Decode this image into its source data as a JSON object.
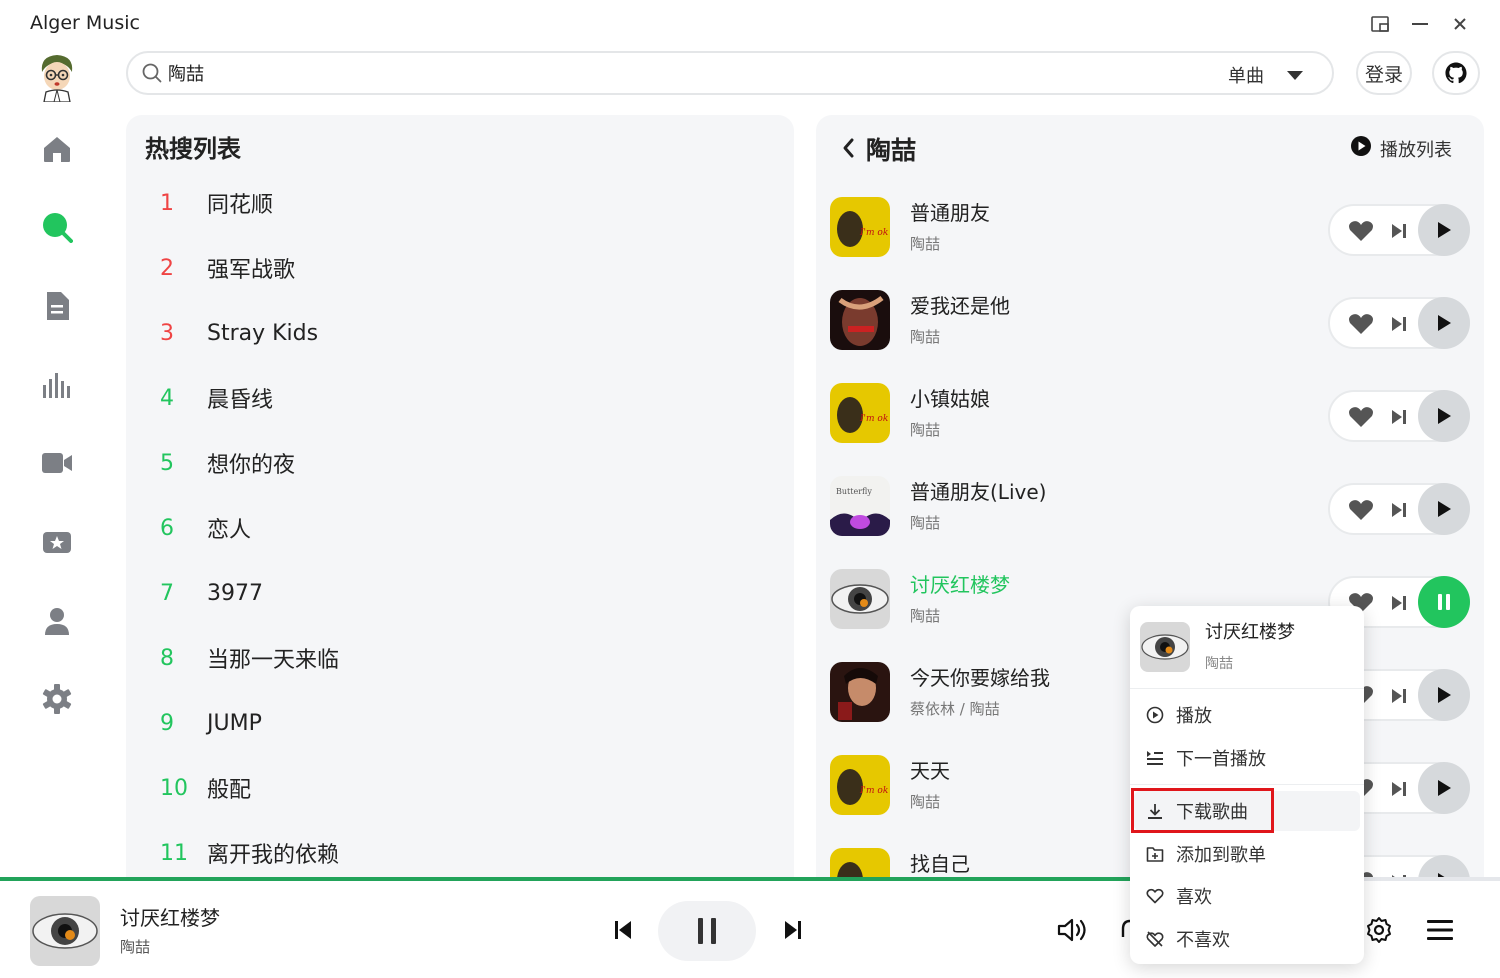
{
  "app": {
    "title": "Alger Music"
  },
  "search": {
    "value": "陶喆",
    "type": "单曲"
  },
  "header": {
    "login_label": "登录"
  },
  "hot": {
    "title": "热搜列表",
    "items": [
      {
        "rank": "1",
        "name": "同花顺"
      },
      {
        "rank": "2",
        "name": "强军战歌"
      },
      {
        "rank": "3",
        "name": "Stray Kids"
      },
      {
        "rank": "4",
        "name": "晨昏线"
      },
      {
        "rank": "5",
        "name": "想你的夜"
      },
      {
        "rank": "6",
        "name": "恋人"
      },
      {
        "rank": "7",
        "name": "3977"
      },
      {
        "rank": "8",
        "name": "当那一天来临"
      },
      {
        "rank": "9",
        "name": "JUMP"
      },
      {
        "rank": "10",
        "name": "般配"
      },
      {
        "rank": "11",
        "name": "离开我的依赖"
      }
    ]
  },
  "results": {
    "title": "陶喆",
    "playlist_label": "播放列表",
    "songs": [
      {
        "name": "普通朋友",
        "artist": "陶喆"
      },
      {
        "name": "爱我还是他",
        "artist": "陶喆"
      },
      {
        "name": "小镇姑娘",
        "artist": "陶喆"
      },
      {
        "name": "普通朋友(Live)",
        "artist": "陶喆"
      },
      {
        "name": "讨厌红楼梦",
        "artist": "陶喆"
      },
      {
        "name": "今天你要嫁给我",
        "artist": "蔡依林 / 陶喆"
      },
      {
        "name": "天天",
        "artist": "陶喆"
      },
      {
        "name": "找自己",
        "artist": ""
      }
    ]
  },
  "context_menu": {
    "song": "讨厌红楼梦",
    "artist": "陶喆",
    "items": [
      {
        "label": "播放",
        "icon": "play-circle-icon"
      },
      {
        "label": "下一首播放",
        "icon": "play-next-icon"
      },
      {
        "label": "下载歌曲",
        "icon": "download-icon"
      },
      {
        "label": "添加到歌单",
        "icon": "add-to-playlist-icon"
      },
      {
        "label": "喜欢",
        "icon": "heart-outline-icon"
      },
      {
        "label": "不喜欢",
        "icon": "dislike-icon"
      }
    ]
  },
  "player": {
    "song": "讨厌红楼梦",
    "artist": "陶喆",
    "progress": 0.76
  },
  "colors": {
    "accent": "#22c55e",
    "rank_top": "#ef4444",
    "rank_other": "#22c55e",
    "highlight": "#e0161b"
  }
}
